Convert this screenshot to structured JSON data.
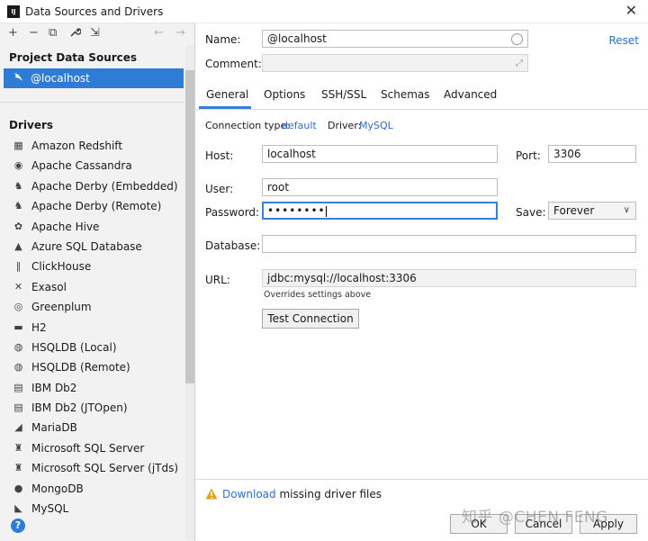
{
  "window": {
    "icon_text": "IJ",
    "title": "Data Sources and Drivers",
    "close_glyph": "✕"
  },
  "sidebar": {
    "toolbar": {
      "add": "+",
      "remove": "−",
      "copy": "⧉",
      "settings": "🔧",
      "import": "⇲",
      "back": "←",
      "forward": "→"
    },
    "project_header": "Project Data Sources",
    "data_source": {
      "name": "@localhost",
      "icon": "dolphin-icon"
    },
    "drivers_header": "Drivers",
    "drivers": [
      {
        "label": "Amazon Redshift",
        "icon": "▦",
        "icon_name": "redshift-icon"
      },
      {
        "label": "Apache Cassandra",
        "icon": "◉",
        "icon_name": "cassandra-icon"
      },
      {
        "label": "Apache Derby (Embedded)",
        "icon": "♞",
        "icon_name": "derby-icon"
      },
      {
        "label": "Apache Derby (Remote)",
        "icon": "♞",
        "icon_name": "derby-icon"
      },
      {
        "label": "Apache Hive",
        "icon": "✿",
        "icon_name": "hive-icon"
      },
      {
        "label": "Azure SQL Database",
        "icon": "▲",
        "icon_name": "azure-icon"
      },
      {
        "label": "ClickHouse",
        "icon": "‖",
        "icon_name": "clickhouse-icon"
      },
      {
        "label": "Exasol",
        "icon": "✕",
        "icon_name": "exasol-icon"
      },
      {
        "label": "Greenplum",
        "icon": "◎",
        "icon_name": "greenplum-icon"
      },
      {
        "label": "H2",
        "icon": "▬",
        "icon_name": "h2-icon"
      },
      {
        "label": "HSQLDB (Local)",
        "icon": "◍",
        "icon_name": "hsqldb-icon"
      },
      {
        "label": "HSQLDB (Remote)",
        "icon": "◍",
        "icon_name": "hsqldb-icon"
      },
      {
        "label": "IBM Db2",
        "icon": "▤",
        "icon_name": "ibm-icon"
      },
      {
        "label": "IBM Db2 (JTOpen)",
        "icon": "▤",
        "icon_name": "ibm-icon"
      },
      {
        "label": "MariaDB",
        "icon": "◢",
        "icon_name": "mariadb-icon"
      },
      {
        "label": "Microsoft SQL Server",
        "icon": "♜",
        "icon_name": "mssql-icon"
      },
      {
        "label": "Microsoft SQL Server (jTds)",
        "icon": "♜",
        "icon_name": "mssql-icon"
      },
      {
        "label": "MongoDB",
        "icon": "●",
        "icon_name": "mongodb-icon"
      },
      {
        "label": "MySQL",
        "icon": "◣",
        "icon_name": "mysql-icon"
      }
    ],
    "help": "?"
  },
  "form": {
    "name_label": "Name:",
    "name_value": "@localhost",
    "comment_label": "Comment:",
    "comment_value": "",
    "reset": "Reset",
    "tabs": [
      "General",
      "Options",
      "SSH/SSL",
      "Schemas",
      "Advanced"
    ],
    "connection_type_label": "Connection type:",
    "connection_type_value": "default",
    "driver_label": "Driver:",
    "driver_value": "MySQL",
    "host_label": "Host:",
    "host_value": "localhost",
    "port_label": "Port:",
    "port_value": "3306",
    "user_label": "User:",
    "user_value": "root",
    "password_label": "Password:",
    "password_value": "••••••••",
    "save_label": "Save:",
    "save_value": "Forever",
    "database_label": "Database:",
    "database_value": "",
    "url_label": "URL:",
    "url_value": "jdbc:mysql://localhost:3306",
    "url_hint": "Overrides settings above",
    "test_connection": "Test Connection"
  },
  "footer": {
    "download_link": "Download",
    "download_rest": " missing driver files",
    "ok": "OK",
    "cancel": "Cancel",
    "apply": "Apply",
    "watermark": "知乎 @CHEN FENG"
  },
  "colors": {
    "accent": "#2f7cd6",
    "link": "#2f6fc5",
    "warning": "#e0a31a"
  }
}
